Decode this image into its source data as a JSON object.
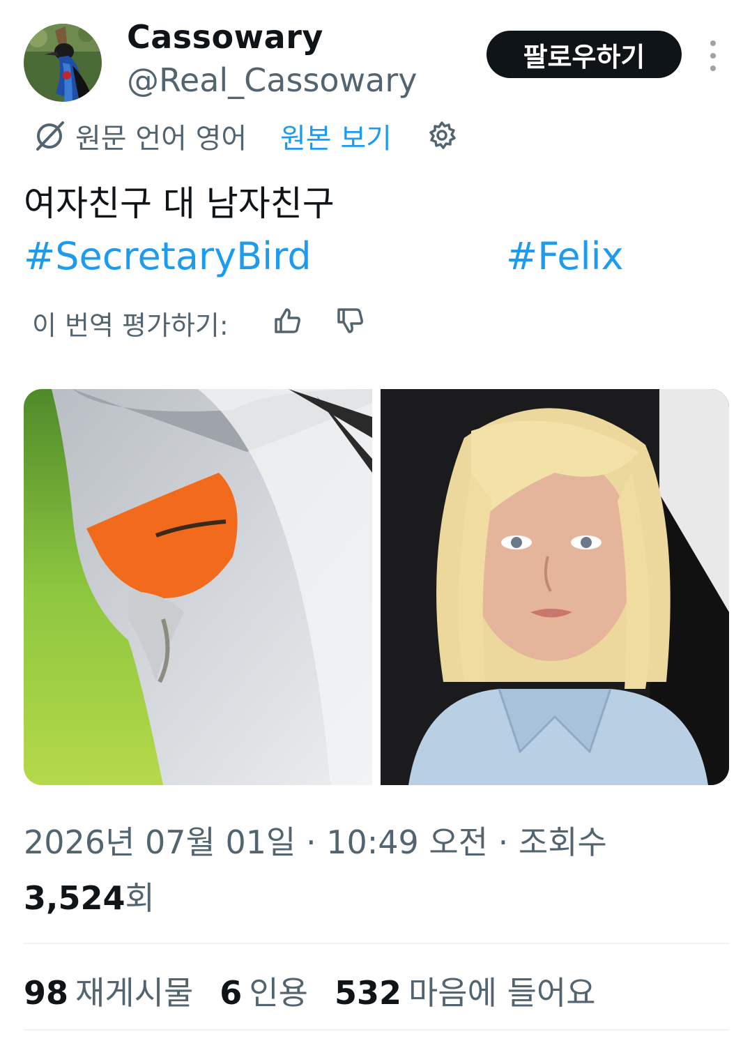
{
  "author": {
    "display_name": "Cassowary",
    "handle": "@Real_Cassowary",
    "follow_label": "팔로우하기"
  },
  "translation": {
    "notice": "원문 언어 영어",
    "show_original": "원본 보기"
  },
  "tweet": {
    "text": "여자친구 대 남자친구",
    "hashtags": [
      "#SecretaryBird",
      "#Felix"
    ],
    "rate_translation": "이 번역 평가하기:"
  },
  "meta": {
    "timestamp": "2026년 07월 01일 · 10:49 오전 · 조회수",
    "views_count": "3,524",
    "views_suffix": "회"
  },
  "stats": {
    "retweets_count": "98",
    "retweets_label": "재게시물",
    "quotes_count": "6",
    "quotes_label": "인용",
    "likes_count": "532",
    "likes_label": "마음에 들어요"
  },
  "colors": {
    "link": "#1d9bf0",
    "secondary_text": "#536471",
    "primary_text": "#0f1419"
  }
}
